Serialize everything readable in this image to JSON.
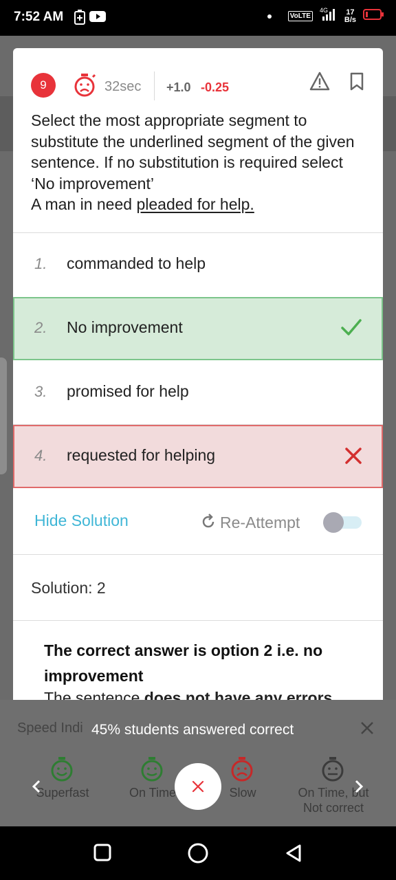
{
  "status_bar": {
    "time": "7:52 AM",
    "network_label": "VoLTE",
    "network_gen": "4G",
    "speed_value": "17",
    "speed_unit": "B/s"
  },
  "question": {
    "number": "9",
    "time_taken": "32sec",
    "positive_marks": "+1.0",
    "negative_marks": "-0.25",
    "prompt": "Select the most appropriate segment to substitute the underlined segment of the given sentence. If no substitution is required select ‘No improvement’",
    "sentence_prefix": "A man in need ",
    "sentence_underlined": "pleaded for help."
  },
  "options": [
    {
      "num": "1.",
      "text": "commanded to help",
      "state": "normal"
    },
    {
      "num": "2.",
      "text": "No improvement",
      "state": "correct"
    },
    {
      "num": "3.",
      "text": "promised for help",
      "state": "normal"
    },
    {
      "num": "4.",
      "text": "requested for helping",
      "state": "wrong"
    }
  ],
  "solution_controls": {
    "hide_solution_label": "Hide Solution",
    "reattempt_label": "Re-Attempt",
    "reattempt_toggle_on": false
  },
  "solution": {
    "label": "Solution: 2",
    "heading": "The correct answer is option 2 i.e. no improvement",
    "partial_line_prefix": "The sentence ",
    "partial_line_bold": "does not have any errors"
  },
  "bottom_sheet": {
    "title": "Speed Indi",
    "banner": "45% students answered correct",
    "speeds": [
      {
        "label": "Superfast",
        "label2": ""
      },
      {
        "label": "On Time",
        "label2": ""
      },
      {
        "label": "Slow",
        "label2": ""
      },
      {
        "label": "On Time, but",
        "label2": "Not correct"
      }
    ]
  },
  "colors": {
    "accent_red": "#e8333a",
    "correct_green": "#4caf50",
    "wrong_red": "#d32f2f",
    "link_blue": "#3fb6d6"
  }
}
